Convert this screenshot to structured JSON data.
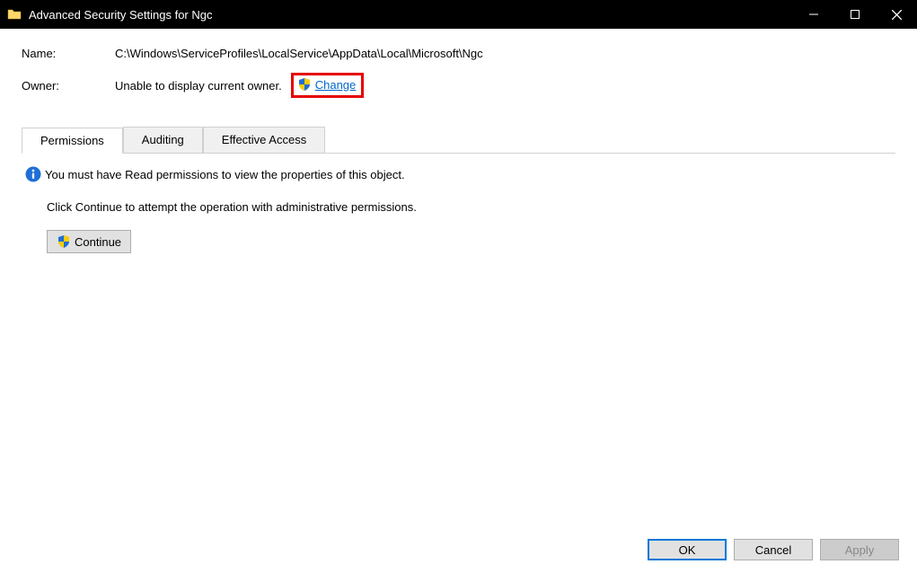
{
  "window": {
    "title": "Advanced Security Settings for Ngc"
  },
  "fields": {
    "name_label": "Name:",
    "name_value": "C:\\Windows\\ServiceProfiles\\LocalService\\AppData\\Local\\Microsoft\\Ngc",
    "owner_label": "Owner:",
    "owner_value": "Unable to display current owner.",
    "change_link": "Change"
  },
  "tabs": {
    "permissions": "Permissions",
    "auditing": "Auditing",
    "effective": "Effective Access"
  },
  "panel": {
    "info_text": "You must have Read permissions to view the properties of this object.",
    "instruction": "Click Continue to attempt the operation with administrative permissions.",
    "continue_label": "Continue"
  },
  "footer": {
    "ok": "OK",
    "cancel": "Cancel",
    "apply": "Apply"
  }
}
